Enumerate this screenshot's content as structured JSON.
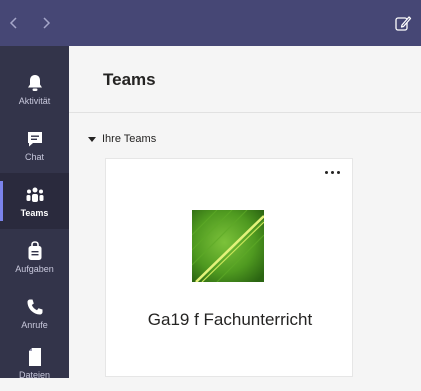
{
  "colors": {
    "topbar": "#464775",
    "rail": "#33344a",
    "rail_active_indicator": "#7b83eb"
  },
  "topbar": {
    "back_icon": "chevron-left-icon",
    "forward_icon": "chevron-right-icon",
    "compose_icon": "compose-icon"
  },
  "rail": {
    "items": [
      {
        "label": "Aktivität",
        "icon": "bell-icon",
        "active": false
      },
      {
        "label": "Chat",
        "icon": "chat-icon",
        "active": false
      },
      {
        "label": "Teams",
        "icon": "teams-icon",
        "active": true
      },
      {
        "label": "Aufgaben",
        "icon": "assignments-icon",
        "active": false
      },
      {
        "label": "Anrufe",
        "icon": "phone-icon",
        "active": false
      },
      {
        "label": "Dateien",
        "icon": "file-icon",
        "active": false
      }
    ]
  },
  "main": {
    "title": "Teams",
    "section_label": "Ihre Teams",
    "teams": [
      {
        "name": "Ga19 f Fachunterricht",
        "avatar": "leaf-image"
      }
    ]
  }
}
